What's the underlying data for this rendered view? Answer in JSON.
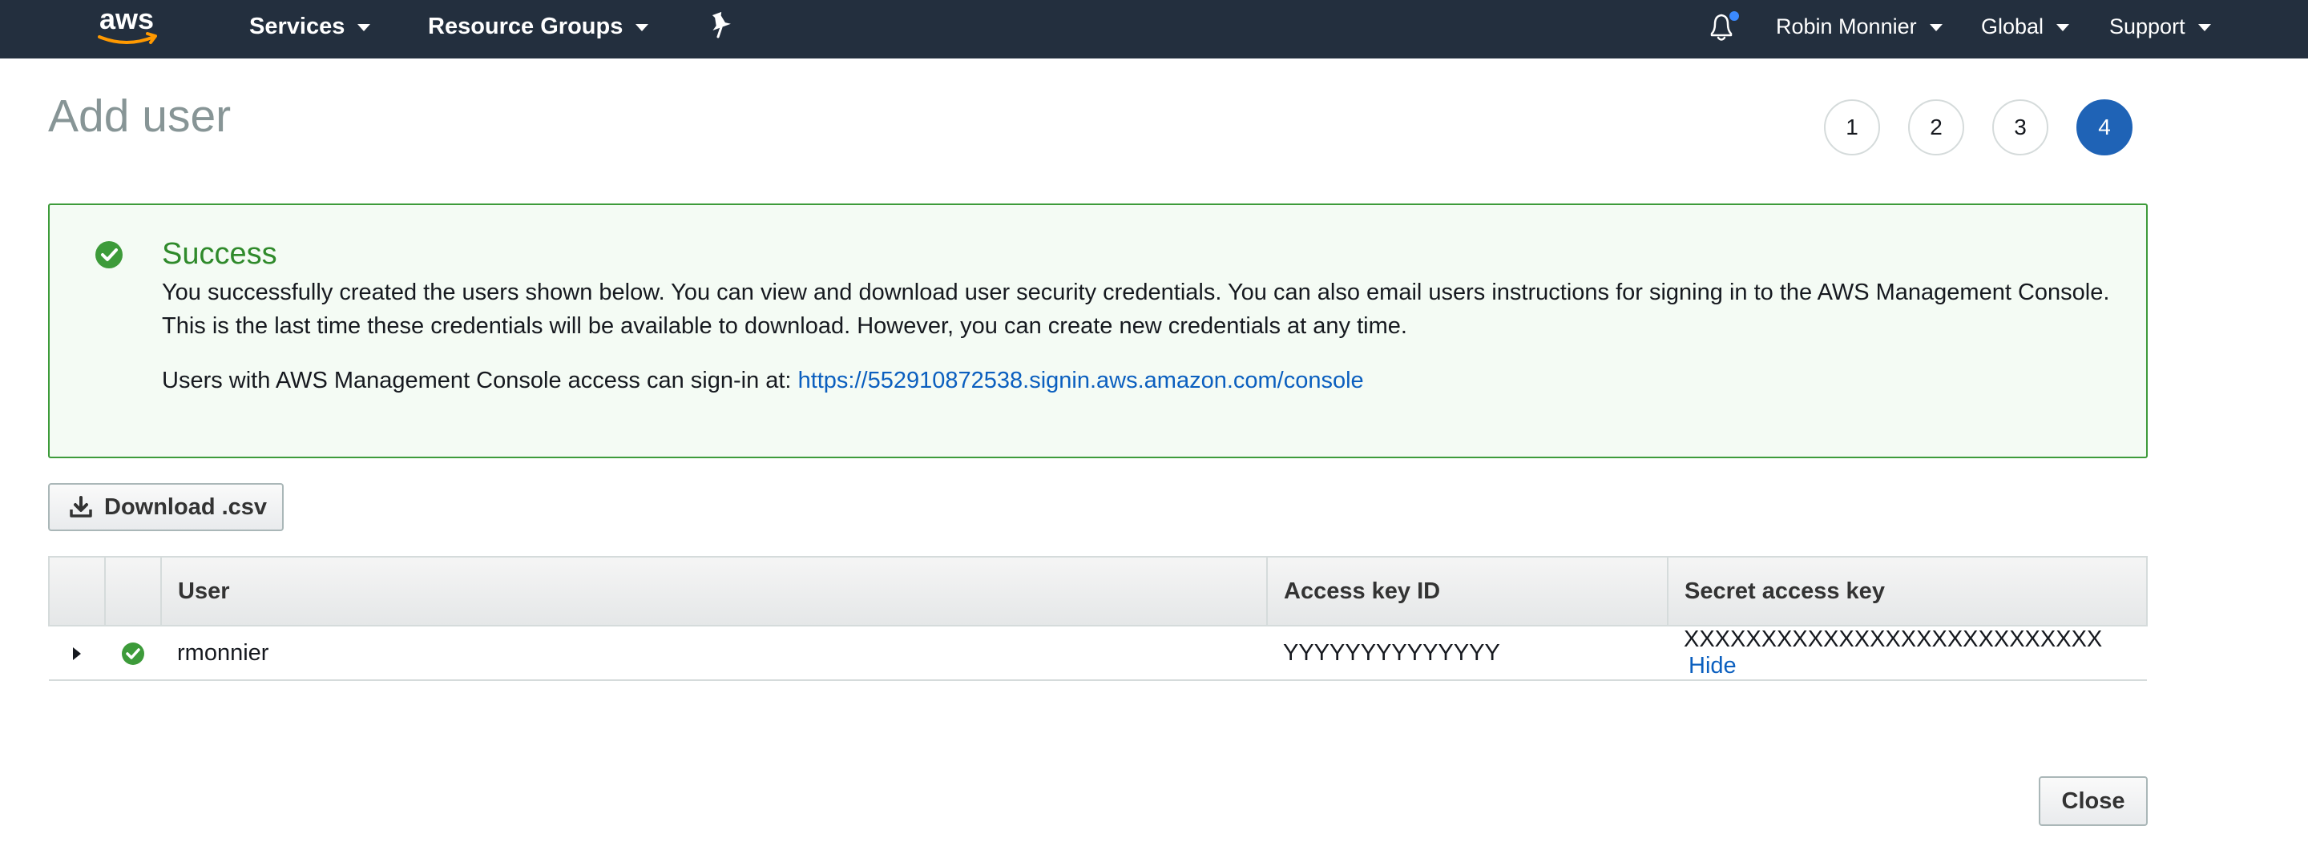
{
  "nav": {
    "services_label": "Services",
    "resource_groups_label": "Resource Groups",
    "user_label": "Robin Monnier",
    "region_label": "Global",
    "support_label": "Support",
    "brand_color": "#232f3e",
    "logo_accent_color": "#ff9900",
    "notification_dot_color": "#3b8aff"
  },
  "page": {
    "title": "Add user",
    "steps": [
      "1",
      "2",
      "3",
      "4"
    ],
    "active_step": "4"
  },
  "alert": {
    "title": "Success",
    "line1": "You successfully created the users shown below. You can view and download user security credentials. You can also email users instructions for signing in to the AWS Management Console.",
    "line2": "This is the last time these credentials will be available to download. However, you can create new credentials at any time.",
    "signin_prefix": "Users with AWS Management Console access can sign-in at:",
    "signin_url": "https://552910872538.signin.aws.amazon.com/console",
    "success_color": "#3d9b3a"
  },
  "actions": {
    "download_label": "Download .csv",
    "close_label": "Close"
  },
  "table": {
    "headers": {
      "user": "User",
      "access_key_id": "Access key ID",
      "secret_access_key": "Secret access key"
    },
    "rows": [
      {
        "user": "rmonnier",
        "access_key_id": "YYYYYYYYYYYYYY",
        "secret_access_key": "XXXXXXXXXXXXXXXXXXXXXXXXXXX",
        "hide_label": "Hide"
      }
    ]
  }
}
